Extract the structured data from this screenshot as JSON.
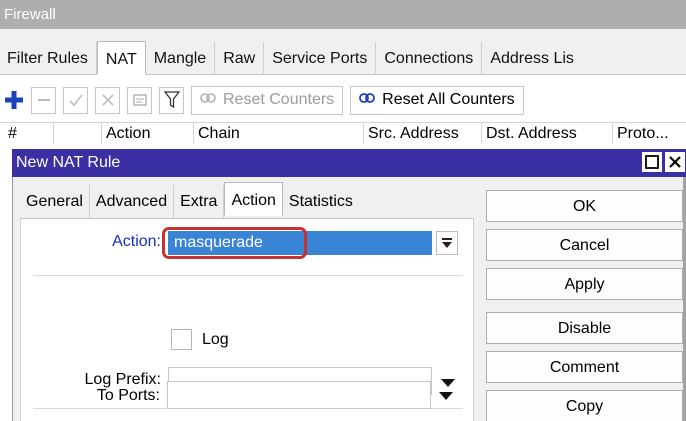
{
  "window": {
    "title": "Firewall"
  },
  "tabs": [
    "Filter Rules",
    "NAT",
    "Mangle",
    "Raw",
    "Service Ports",
    "Connections",
    "Address Lis"
  ],
  "active_tab": "NAT",
  "toolbar": {
    "reset_counters": "Reset Counters",
    "reset_all_counters": "Reset All Counters"
  },
  "columns": [
    "#",
    "",
    "Action",
    "Chain",
    "Src. Address",
    "Dst. Address",
    "Proto..."
  ],
  "dialog": {
    "title": "New NAT Rule",
    "tabs": [
      "General",
      "Advanced",
      "Extra",
      "Action",
      "Statistics"
    ],
    "active_tab": "Action",
    "fields": {
      "action_label": "Action:",
      "action_value": "masquerade",
      "log_label": "Log",
      "log_prefix_label": "Log Prefix:",
      "log_prefix_value": "",
      "to_ports_label": "To Ports:",
      "to_ports_value": ""
    },
    "buttons": [
      "OK",
      "Cancel",
      "Apply",
      "Disable",
      "Comment",
      "Copy"
    ]
  },
  "colors": {
    "title_bar": "#3a30a3",
    "selection": "#3a84d6",
    "highlight": "#c8312d",
    "add_icon": "#1a3fbf"
  },
  "icons": [
    "add-icon",
    "remove-icon",
    "enable-icon",
    "disable-icon",
    "comment-icon",
    "filter-icon",
    "reset-icon",
    "reset-all-icon",
    "dropdown-icon",
    "minimize-icon",
    "close-icon"
  ]
}
